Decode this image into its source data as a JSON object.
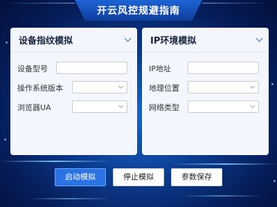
{
  "window": {
    "title": "开云风控规避指南"
  },
  "device_panel": {
    "title": "设备指纹模拟",
    "fields": [
      {
        "label": "设备型号",
        "type": "text",
        "value": ""
      },
      {
        "label": "操作系统版本",
        "type": "select",
        "value": ""
      },
      {
        "label": "浏览器UA",
        "type": "select",
        "value": ""
      }
    ]
  },
  "ip_panel": {
    "title": "IP环境模拟",
    "fields": [
      {
        "label": "IP地址",
        "type": "text",
        "value": ""
      },
      {
        "label": "地理位置",
        "type": "select",
        "value": ""
      },
      {
        "label": "网络类型",
        "type": "select",
        "value": ""
      }
    ]
  },
  "actions": {
    "start": "启动模拟",
    "stop": "停止模拟",
    "save": "参数保存"
  },
  "colors": {
    "accent": "#2b73e3",
    "background": "#0c3f94"
  },
  "icons": {
    "collapse": "chevron-down-icon",
    "dropdown": "dropdown-arrow-icon"
  }
}
